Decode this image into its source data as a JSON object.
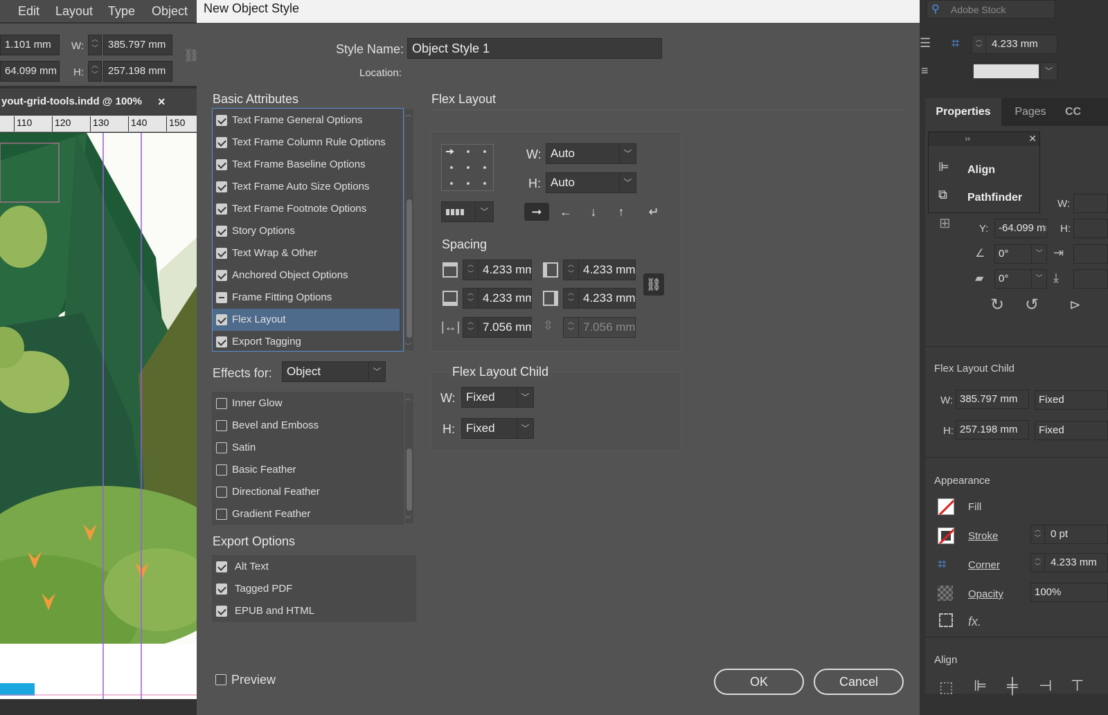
{
  "menu": {
    "edit": "Edit",
    "layout": "Layout",
    "type": "Type",
    "object": "Object"
  },
  "control": {
    "x_value": "1.101 mm",
    "y_value": "64.099 mm",
    "w_label": "W:",
    "h_label": "H:",
    "w_value": "385.797 mm",
    "h_value": "257.198 mm"
  },
  "document_tab": {
    "title": "yout-grid-tools.indd @ 100%",
    "close": "×"
  },
  "ruler": {
    "ticks": [
      "110",
      "120",
      "130",
      "140",
      "150"
    ]
  },
  "dialog": {
    "title": "New Object Style",
    "style_name_label": "Style Name:",
    "style_name_value": "Object Style 1",
    "location_label": "Location:",
    "basic_attributes_header": "Basic Attributes",
    "basic_attributes": [
      {
        "label": "Text Frame General Options",
        "state": "checked"
      },
      {
        "label": "Text Frame Column Rule Options",
        "state": "checked"
      },
      {
        "label": "Text Frame Baseline Options",
        "state": "checked"
      },
      {
        "label": "Text Frame Auto Size Options",
        "state": "checked"
      },
      {
        "label": "Text Frame Footnote Options",
        "state": "checked"
      },
      {
        "label": "Story Options",
        "state": "checked"
      },
      {
        "label": "Text Wrap & Other",
        "state": "checked"
      },
      {
        "label": "Anchored Object Options",
        "state": "checked"
      },
      {
        "label": "Frame Fitting Options",
        "state": "mixed"
      },
      {
        "label": "Flex Layout",
        "state": "checked",
        "selected": true
      },
      {
        "label": "Export Tagging",
        "state": "checked"
      }
    ],
    "effects_for_label": "Effects for:",
    "effects_for_value": "Object",
    "effects": [
      {
        "label": "Inner Glow",
        "state": "unchecked"
      },
      {
        "label": "Bevel and Emboss",
        "state": "unchecked"
      },
      {
        "label": "Satin",
        "state": "unchecked"
      },
      {
        "label": "Basic Feather",
        "state": "unchecked"
      },
      {
        "label": "Directional Feather",
        "state": "unchecked"
      },
      {
        "label": "Gradient Feather",
        "state": "unchecked"
      }
    ],
    "export_options_header": "Export Options",
    "export_options": [
      {
        "label": "Alt Text",
        "state": "checked"
      },
      {
        "label": "Tagged PDF",
        "state": "checked"
      },
      {
        "label": "EPUB and HTML",
        "state": "checked"
      }
    ],
    "flex_layout": {
      "header": "Flex Layout",
      "w_label": "W:",
      "w_value": "Auto",
      "h_label": "H:",
      "h_value": "Auto",
      "direction_selected": "right",
      "spacing_header": "Spacing",
      "spacing_top": "4.233 mm",
      "spacing_left": "4.233 mm",
      "spacing_bottom": "4.233 mm",
      "spacing_right": "4.233 mm",
      "gap_horizontal": "7.056 mm",
      "gap_vertical": "7.056 mm"
    },
    "flex_layout_child": {
      "header": "Flex Layout Child",
      "w_label": "W:",
      "w_value": "Fixed",
      "h_label": "H:",
      "h_value": "Fixed"
    },
    "preview_label": "Preview",
    "ok_label": "OK",
    "cancel_label": "Cancel"
  },
  "right_panel": {
    "search_placeholder": "Adobe Stock",
    "corner_value": "4.233 mm",
    "tabs": [
      "Properties",
      "Pages",
      "CC"
    ],
    "popup_items": [
      "Align",
      "Pathfinder"
    ],
    "w_label": "W:",
    "h_label": "H:",
    "y_label": "Y:",
    "y_value": "-64.099 mm",
    "rotation": "0°",
    "shear": "0°",
    "flex_child_header": "Flex Layout Child",
    "flex_child_w": "385.797 mm",
    "flex_child_w_mode": "Fixed",
    "flex_child_h": "257.198 mm",
    "flex_child_h_mode": "Fixed",
    "appearance_header": "Appearance",
    "fill_label": "Fill",
    "stroke_label": "Stroke",
    "stroke_value": "0 pt",
    "corner_label": "Corner",
    "corner_value2": "4.233 mm",
    "opacity_label": "Opacity",
    "opacity_value": "100%",
    "fx_label": "fx.",
    "align_header": "Align"
  },
  "colors": {
    "selection": "#4e6b8c",
    "dialog_bg": "#535353",
    "panel_bg": "#323232"
  }
}
